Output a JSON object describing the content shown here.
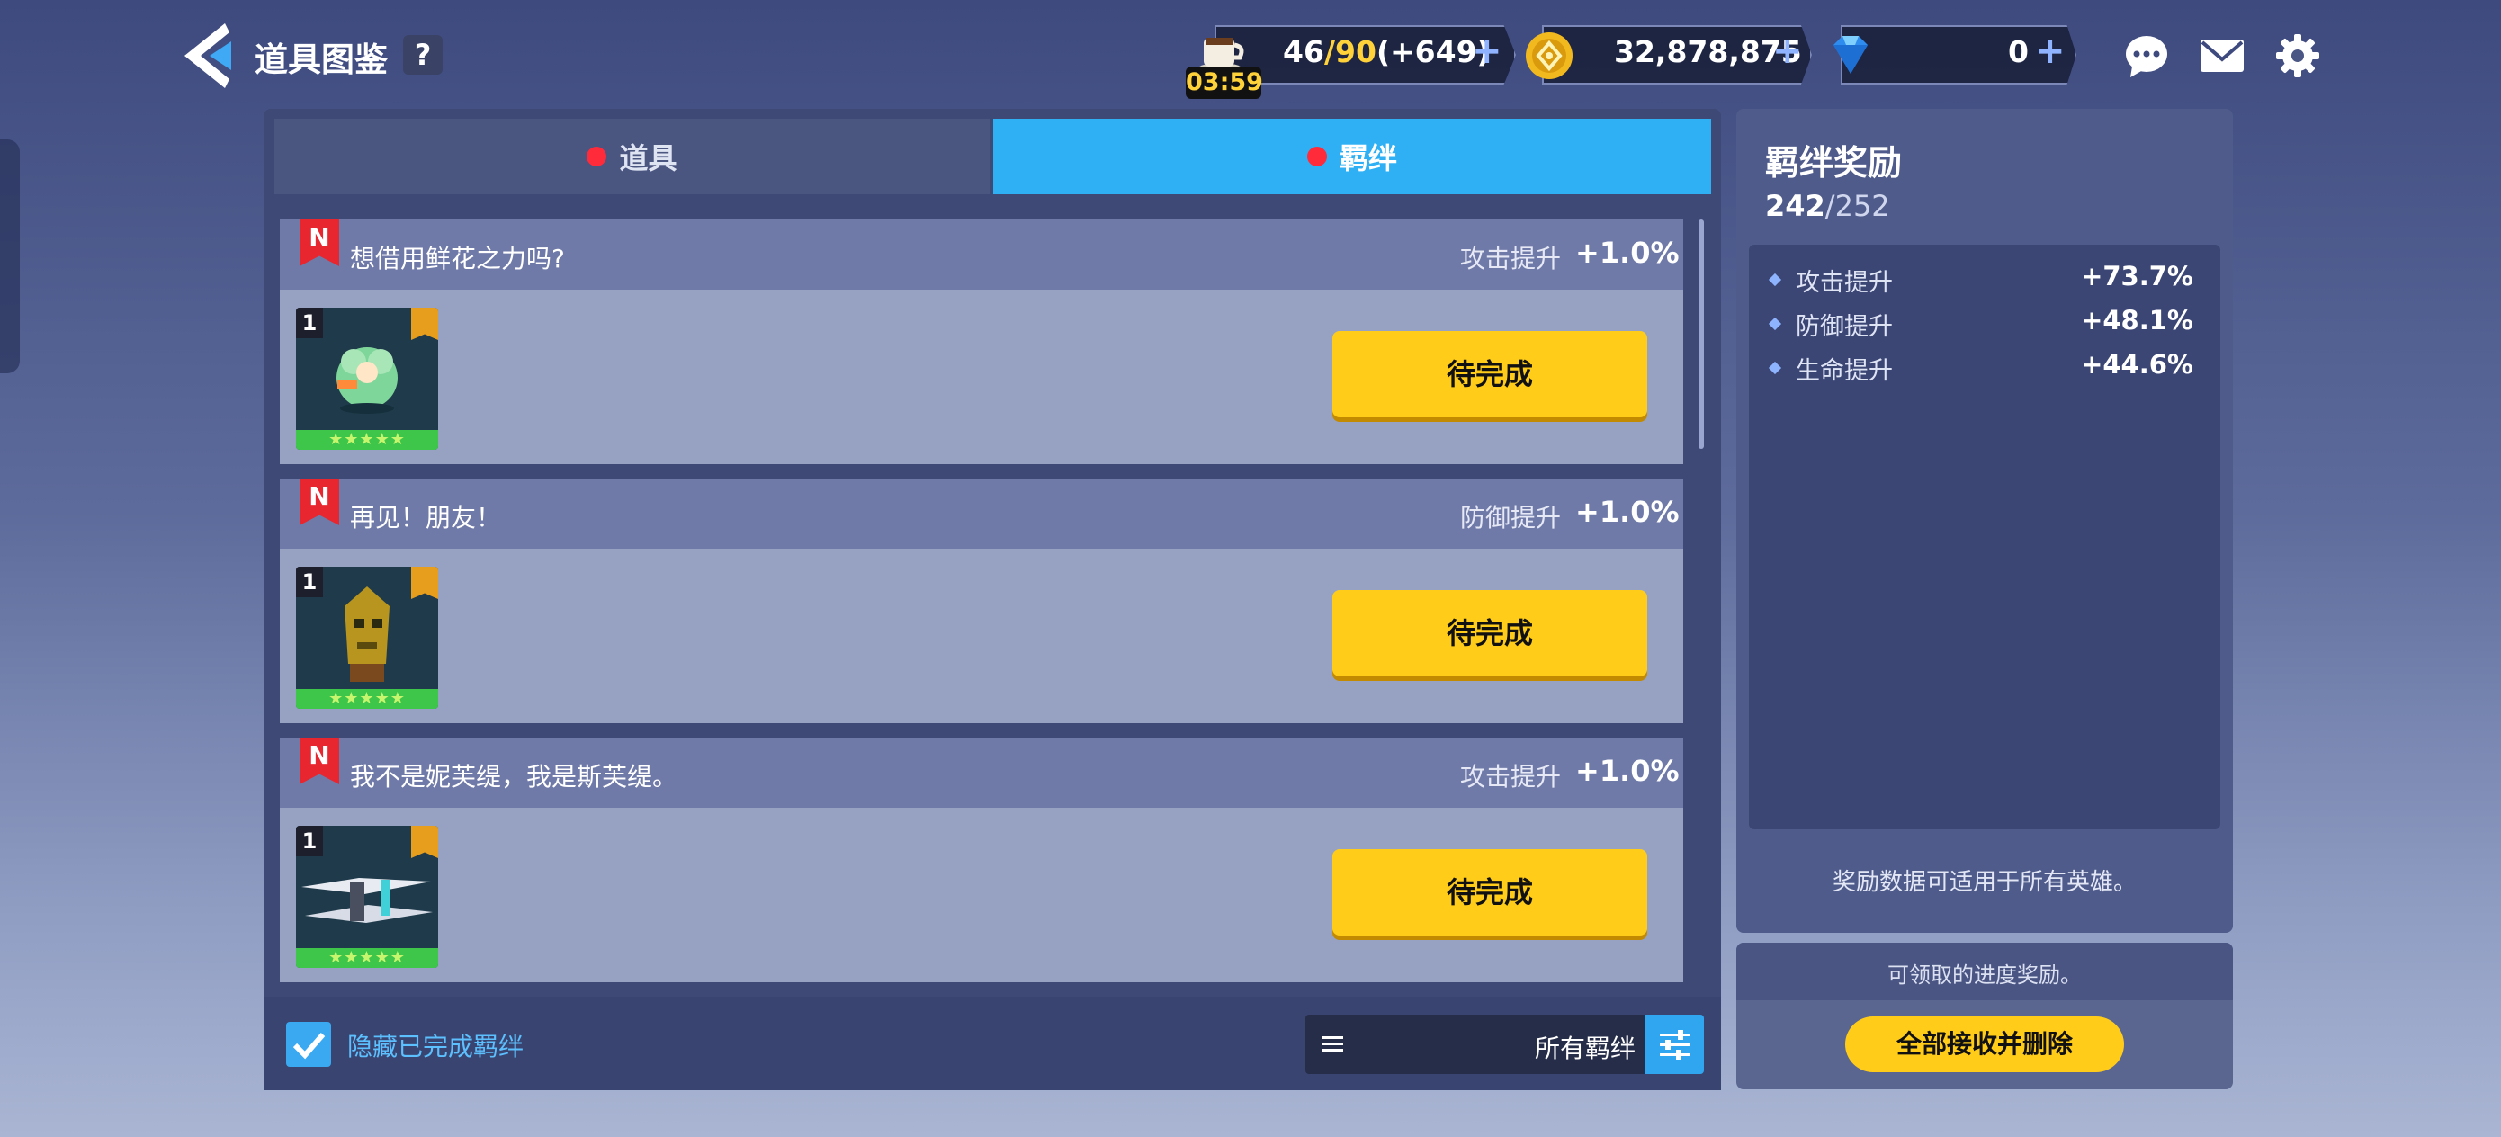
{
  "header": {
    "title": "道具图鉴",
    "help_label": "?",
    "stamina": {
      "text": "46/90(+649)",
      "current": "46",
      "max": "90",
      "extra": "(+649)",
      "timer": "03:59"
    },
    "gold": "32,878,875",
    "gems": "0",
    "plus": "+"
  },
  "tabs": [
    {
      "label": "道具",
      "active": false
    },
    {
      "label": "羁绊",
      "active": true
    }
  ],
  "cards": [
    {
      "badge": "N",
      "title": "想借用鲜花之力吗?",
      "bonus_label": "攻击提升",
      "bonus_value": "+1.0%",
      "qty": "1",
      "stars": "★★★★★",
      "button": "待完成",
      "icon": "flower-creature-icon"
    },
    {
      "badge": "N",
      "title": "再见！朋友！",
      "bonus_label": "防御提升",
      "bonus_value": "+1.0%",
      "qty": "1",
      "stars": "★★★★★",
      "button": "待完成",
      "icon": "golden-mask-idol-icon"
    },
    {
      "badge": "N",
      "title": "我不是妮芙缇，我是斯芙缇。",
      "bonus_label": "攻击提升",
      "bonus_value": "+1.0%",
      "qty": "1",
      "stars": "★★★★★",
      "button": "待完成",
      "icon": "twin-blades-icon"
    }
  ],
  "footer": {
    "hide_completed_label": "隐藏已完成羁绊",
    "hide_completed_checked": true,
    "filter_label": "所有羁绊"
  },
  "reward_panel": {
    "title": "羁绊奖励",
    "progress_current": "242",
    "progress_total": "/252",
    "stats": [
      {
        "name": "攻击提升",
        "value": "+73.7%"
      },
      {
        "name": "防御提升",
        "value": "+48.1%"
      },
      {
        "name": "生命提升",
        "value": "+44.6%"
      }
    ],
    "note": "奖励数据可适用于所有英雄。",
    "claimable_label": "可领取的进度奖励。",
    "claim_button": "全部接收并删除"
  },
  "colors": {
    "accent_tab": "#2fb0f4",
    "pending_button": "#ffcc1a",
    "flag_red": "#e8262f",
    "tab_dot": "#ff2b3a"
  }
}
